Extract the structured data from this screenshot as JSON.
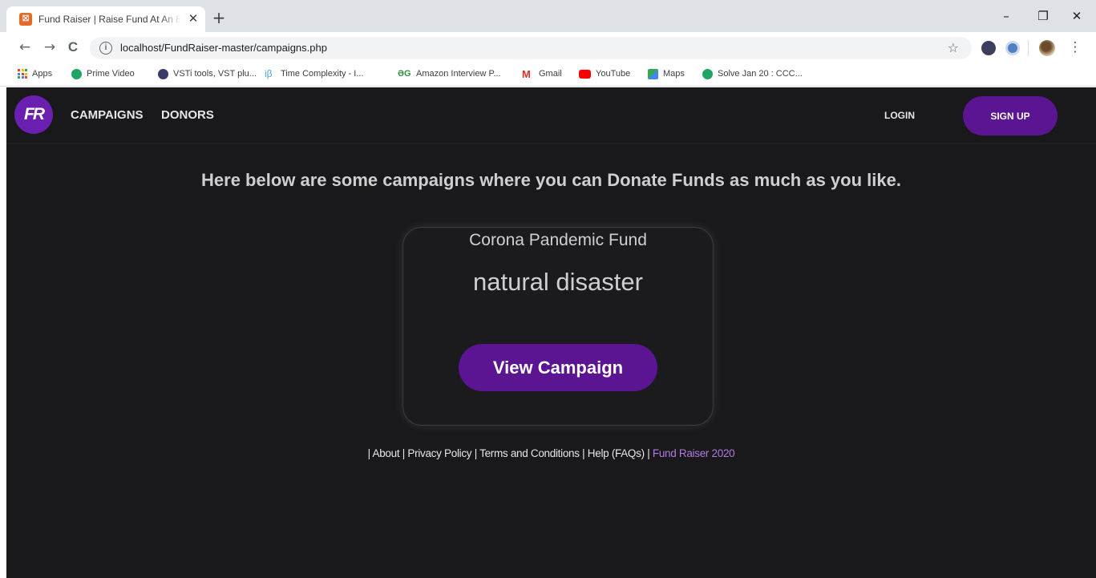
{
  "browser": {
    "tab_title": "Fund Raiser | Raise Fund At An Easy Way",
    "tab_favicon": "fund-raiser-favicon",
    "close_tab_glyph": "✕",
    "new_tab_glyph": "+",
    "url": "localhost/FundRaiser-master/campaigns.php",
    "window_controls": {
      "minimize": "–",
      "restore": "❐",
      "close": "✕"
    },
    "nav": {
      "back": "←",
      "forward": "→",
      "reload": "C"
    },
    "bookmark_star": "☆",
    "menu_glyph": "⋮",
    "bookmarks": [
      {
        "label": "Apps",
        "icon": "apps-grid-icon",
        "color": "#ea4335"
      },
      {
        "label": "Prime Video",
        "icon": "prime-video-icon",
        "color": "#1fa463"
      },
      {
        "label": "VSTi tools, VST plu...",
        "icon": "vst-icon",
        "color": "#3a3a6a"
      },
      {
        "label": "Time Complexity - I...",
        "icon": "interviewbit-icon",
        "color": "#4aa3df"
      },
      {
        "label": "Amazon Interview P...",
        "icon": "geeksforgeeks-icon",
        "color": "#2f8d46"
      },
      {
        "label": "Gmail",
        "icon": "gmail-icon",
        "color": "#d93025"
      },
      {
        "label": "YouTube",
        "icon": "youtube-icon",
        "color": "#ff0000"
      },
      {
        "label": "Maps",
        "icon": "maps-icon",
        "color": "#34a853"
      },
      {
        "label": "Solve Jan 20 : CCC...",
        "icon": "codechef-icon",
        "color": "#1fa463"
      }
    ]
  },
  "site": {
    "logo_text": "FR",
    "nav": {
      "campaigns": "CAMPAIGNS",
      "donors": "DONORS",
      "login": "LOGIN",
      "signup": "SIGN UP"
    },
    "intro": "Here below are some campaigns where you can Donate Funds as much as you like.",
    "campaign": {
      "title": "Corona Pandemic Fund",
      "category": "natural disaster",
      "button": "View Campaign"
    },
    "footer": {
      "about": "| About",
      "privacy": "| Privacy Policy",
      "terms": "| Terms and Conditions",
      "help": "| Help (FAQs) |",
      "brand": "Fund Raiser 2020"
    }
  },
  "colors": {
    "page_bg": "#19191c",
    "accent": "#5b1492",
    "brand_text": "#b07ae0",
    "text": "#cfcfcf"
  }
}
